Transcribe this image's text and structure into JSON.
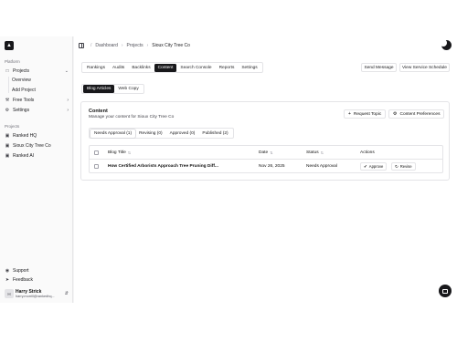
{
  "sidebar": {
    "platform_label": "Platform",
    "projects_label": "Projects",
    "projects_sub": [
      "Overview",
      "Add Project"
    ],
    "free_tools_label": "Free Tools",
    "settings_label": "Settings",
    "projects_section_label": "Projects",
    "project_items": [
      "Ranked HQ",
      "Sioux City Tree Co",
      "Ranked AI"
    ],
    "support_label": "Support",
    "feedback_label": "Feedback",
    "user": {
      "initials": "H",
      "name": "Harry Strick",
      "email": "harry.morrill@rankedhq..."
    }
  },
  "breadcrumb": [
    "Dashboard",
    "Projects",
    "Sioux City Tree Co"
  ],
  "tabs": [
    "Rankings",
    "Audits",
    "Backlinks",
    "Content",
    "Search Console",
    "Reports",
    "Settings"
  ],
  "active_tab": "Content",
  "top_buttons": {
    "send_message": "Send Message",
    "view_service_schedule": "View Service Schedule"
  },
  "subtabs": [
    "Blog Articles",
    "Web Copy"
  ],
  "active_subtab": "Blog Articles",
  "content_card": {
    "title": "Content",
    "description": "Manage your content for Sioux City Tree Co",
    "request_topic": "Request Topic",
    "content_preferences": "Content Preferences",
    "filters": [
      "Needs Approval (1)",
      "Revising (0)",
      "Approved (0)",
      "Published (2)"
    ],
    "active_filter": "Needs Approval (1)",
    "table": {
      "headers": [
        "Blog Title",
        "Date",
        "Status",
        "Actions"
      ],
      "rows": [
        {
          "title": "How Certified Arborists Approach Tree Pruning Diff...",
          "date": "Nov 26, 2025",
          "status": "Needs Approval",
          "approve": "Approve",
          "revise": "Revise"
        }
      ]
    }
  },
  "colors": {
    "accent": "#18181b",
    "background": "#f4f4f5",
    "border": "#e4e4e7"
  }
}
